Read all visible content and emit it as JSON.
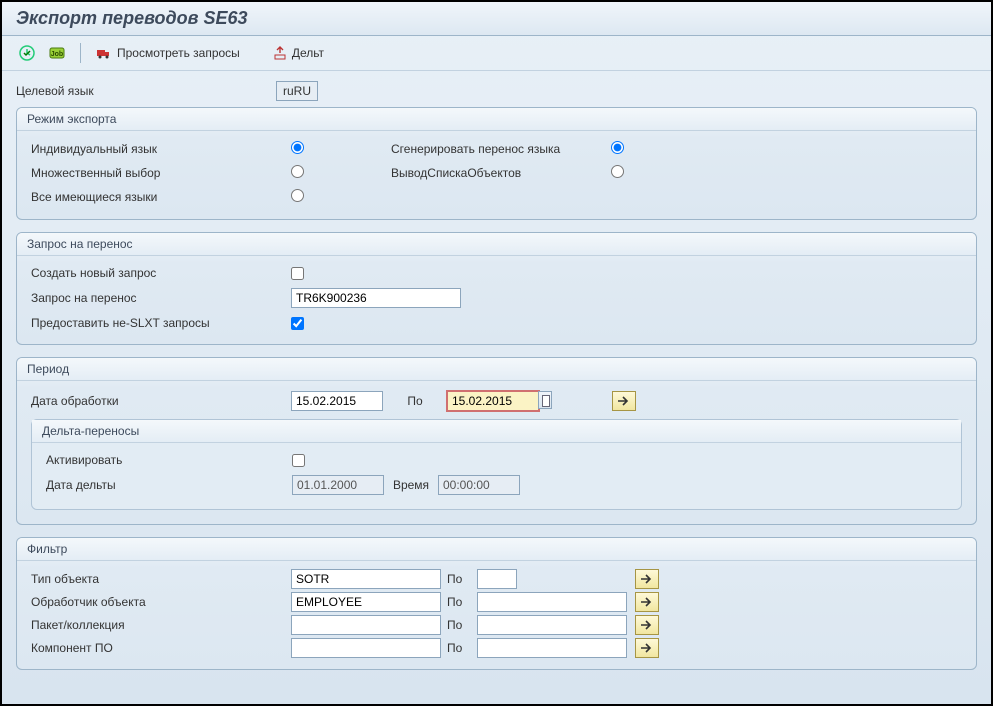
{
  "title": "Экспорт переводов SE63",
  "toolbar": {
    "execute_tip": "Выполнить",
    "job_tip": "Фон",
    "view_requests": "Просмотреть запросы",
    "delta": "Дельт"
  },
  "target_lang": {
    "label": "Целевой язык",
    "value": "ruRU"
  },
  "mode": {
    "title": "Режим экспорта",
    "individual": "Индивидуальный язык",
    "multiple": "Множественный выбор",
    "all": "Все имеющиеся языки",
    "gen_transport": "Сгенерировать перенос языка",
    "obj_list": "ВыводСпискаОбъектов"
  },
  "transport": {
    "title": "Запрос на перенос",
    "create_new": "Создать новый запрос",
    "request_label": "Запрос на перенос",
    "request_value": "TR6K900236",
    "nonslxt": "Предоставить не-SLXT запросы"
  },
  "period": {
    "title": "Период",
    "date_label": "Дата обработки",
    "date_from": "15.02.2015",
    "to_label": "По",
    "date_to": "15.02.2015",
    "delta_title": "Дельта-переносы",
    "activate": "Активировать",
    "delta_date_label": "Дата дельты",
    "delta_date": "01.01.2000",
    "time_label": "Время",
    "time_value": "00:00:00"
  },
  "filter": {
    "title": "Фильтр",
    "to_label": "По",
    "rows": [
      {
        "label": "Тип объекта",
        "from": "SOTR",
        "to": ""
      },
      {
        "label": "Обработчик объекта",
        "from": "EMPLOYEE",
        "to": ""
      },
      {
        "label": "Пакет/коллекция",
        "from": "",
        "to": ""
      },
      {
        "label": "Компонент ПО",
        "from": "",
        "to": ""
      }
    ]
  }
}
